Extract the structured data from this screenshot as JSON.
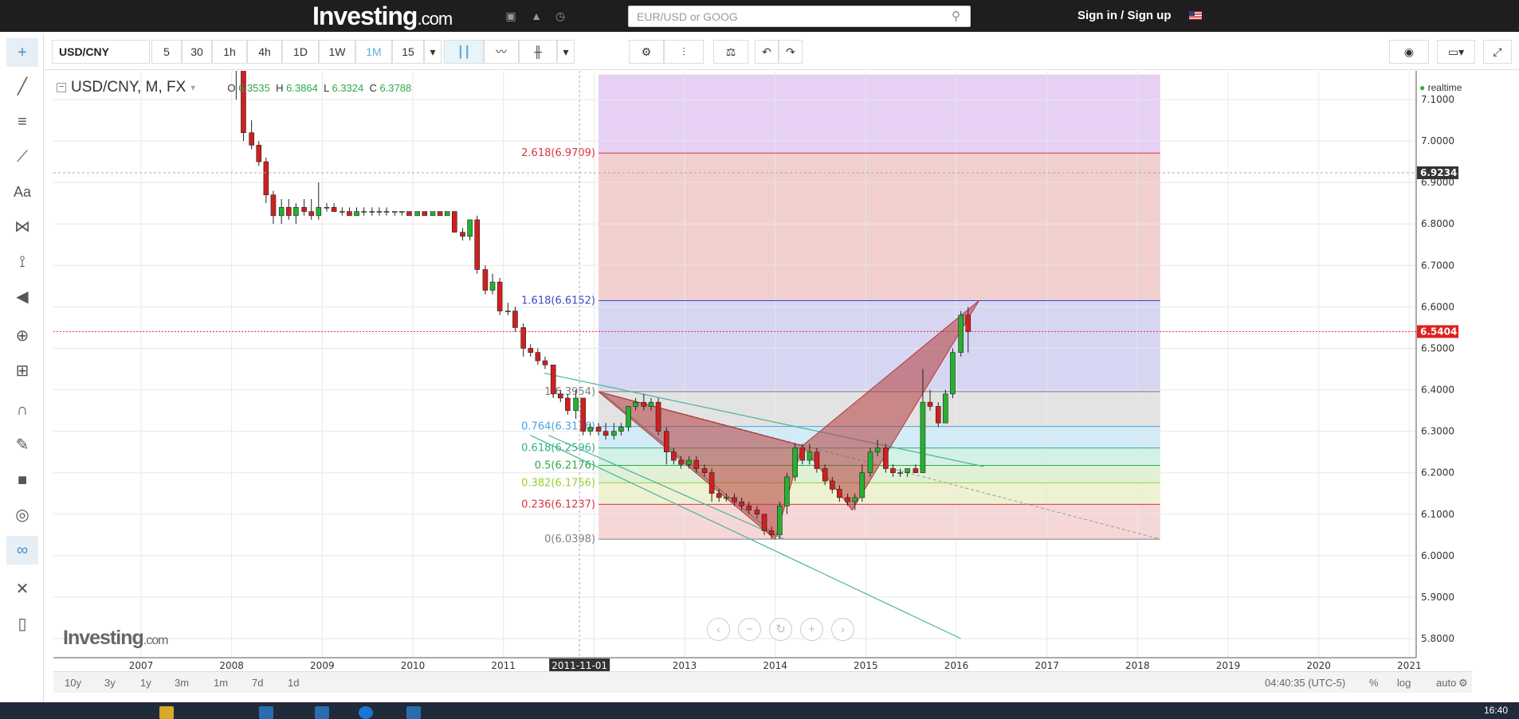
{
  "site": {
    "brand": "Investing",
    "brand_suffix": ".com",
    "search_placeholder": "EUR/USD or GOOG",
    "sign_in": "Sign in",
    "sign_sep": "/",
    "sign_up": "Sign up"
  },
  "toolbar": {
    "symbol": "USD/CNY",
    "intervals": [
      "5",
      "30",
      "1h",
      "4h",
      "1D",
      "1W",
      "1M",
      "15"
    ],
    "active_interval": "1M"
  },
  "legend": {
    "title": "USD/CNY, M, FX",
    "o_label": "O",
    "o": "6.3535",
    "h_label": "H",
    "h": "6.3864",
    "l_label": "L",
    "l": "6.3324",
    "c_label": "C",
    "c": "6.3788",
    "realtime": "realtime"
  },
  "chart_data": {
    "type": "candlestick",
    "x_axis_years": [
      "2007",
      "2008",
      "2009",
      "2010",
      "2011",
      "2012",
      "2013",
      "2014",
      "2015",
      "2016",
      "2017",
      "2018",
      "2019",
      "2020",
      "2021"
    ],
    "crosshair_date": "2011-11-01",
    "ylim": [
      5.76,
      7.16
    ],
    "y_ticks": [
      "7.1000",
      "7.0000",
      "6.9000",
      "6.8000",
      "6.7000",
      "6.6000",
      "6.5000",
      "6.4000",
      "6.3000",
      "6.2000",
      "6.1000",
      "6.0000",
      "5.9000",
      "5.8000"
    ],
    "last_price": "6.5404",
    "crosshair_price": "6.9234",
    "fib_levels": [
      {
        "label": "2.618(6.9709)",
        "value": 6.9709,
        "color": "#d9363e"
      },
      {
        "label": "1.618(6.6152)",
        "value": 6.6152,
        "color": "#4444cc"
      },
      {
        "label": "1(6.3954)",
        "value": 6.3954,
        "color": "#808080"
      },
      {
        "label": "0.764(6.3116)",
        "value": 6.3116,
        "color": "#4aa3df"
      },
      {
        "label": "0.618(6.2596)",
        "value": 6.2596,
        "color": "#2fb17e"
      },
      {
        "label": "0.5(6.2176)",
        "value": 6.2176,
        "color": "#2fa84a"
      },
      {
        "label": "0.382(6.1756)",
        "value": 6.1756,
        "color": "#9acd32"
      },
      {
        "label": "0.236(6.1237)",
        "value": 6.1237,
        "color": "#d9363e"
      },
      {
        "label": "0(6.0398)",
        "value": 6.0398,
        "color": "#808080"
      }
    ],
    "candles_monthly_close": [
      [
        2007.95,
        7.3,
        7.35,
        7.18,
        7.22
      ],
      [
        2008.05,
        7.22,
        7.25,
        7.1,
        7.18
      ],
      [
        2008.13,
        7.18,
        7.2,
        7.0,
        7.02
      ],
      [
        2008.22,
        7.02,
        7.05,
        6.98,
        6.99
      ],
      [
        2008.3,
        6.99,
        7.0,
        6.94,
        6.95
      ],
      [
        2008.38,
        6.95,
        6.96,
        6.85,
        6.87
      ],
      [
        2008.46,
        6.87,
        6.88,
        6.8,
        6.82
      ],
      [
        2008.55,
        6.82,
        6.86,
        6.8,
        6.84
      ],
      [
        2008.63,
        6.84,
        6.86,
        6.81,
        6.82
      ],
      [
        2008.71,
        6.82,
        6.85,
        6.8,
        6.84
      ],
      [
        2008.8,
        6.84,
        6.86,
        6.82,
        6.83
      ],
      [
        2008.88,
        6.83,
        6.86,
        6.81,
        6.82
      ],
      [
        2008.96,
        6.82,
        6.9,
        6.81,
        6.84
      ],
      [
        2009.05,
        6.84,
        6.85,
        6.83,
        6.84
      ],
      [
        2009.13,
        6.84,
        6.85,
        6.83,
        6.83
      ],
      [
        2009.22,
        6.83,
        6.84,
        6.82,
        6.83
      ],
      [
        2009.3,
        6.83,
        6.84,
        6.82,
        6.82
      ],
      [
        2009.38,
        6.82,
        6.84,
        6.82,
        6.83
      ],
      [
        2009.46,
        6.83,
        6.84,
        6.82,
        6.83
      ],
      [
        2009.55,
        6.83,
        6.84,
        6.82,
        6.83
      ],
      [
        2009.63,
        6.83,
        6.84,
        6.82,
        6.83
      ],
      [
        2009.71,
        6.83,
        6.84,
        6.82,
        6.83
      ],
      [
        2009.8,
        6.83,
        6.83,
        6.82,
        6.83
      ],
      [
        2009.88,
        6.83,
        6.83,
        6.82,
        6.83
      ],
      [
        2009.96,
        6.83,
        6.83,
        6.82,
        6.82
      ],
      [
        2010.05,
        6.82,
        6.83,
        6.82,
        6.83
      ],
      [
        2010.13,
        6.83,
        6.83,
        6.82,
        6.82
      ],
      [
        2010.22,
        6.82,
        6.83,
        6.82,
        6.83
      ],
      [
        2010.3,
        6.83,
        6.83,
        6.82,
        6.82
      ],
      [
        2010.38,
        6.82,
        6.83,
        6.82,
        6.83
      ],
      [
        2010.46,
        6.83,
        6.83,
        6.78,
        6.78
      ],
      [
        2010.55,
        6.78,
        6.79,
        6.76,
        6.77
      ],
      [
        2010.63,
        6.77,
        6.81,
        6.76,
        6.81
      ],
      [
        2010.71,
        6.81,
        6.82,
        6.68,
        6.69
      ],
      [
        2010.8,
        6.69,
        6.7,
        6.63,
        6.64
      ],
      [
        2010.88,
        6.64,
        6.68,
        6.63,
        6.66
      ],
      [
        2010.96,
        6.66,
        6.67,
        6.58,
        6.59
      ],
      [
        2011.05,
        6.59,
        6.61,
        6.58,
        6.59
      ],
      [
        2011.13,
        6.59,
        6.6,
        6.54,
        6.55
      ],
      [
        2011.22,
        6.55,
        6.56,
        6.48,
        6.5
      ],
      [
        2011.3,
        6.5,
        6.51,
        6.48,
        6.49
      ],
      [
        2011.38,
        6.49,
        6.5,
        6.46,
        6.47
      ],
      [
        2011.46,
        6.47,
        6.48,
        6.45,
        6.46
      ],
      [
        2011.55,
        6.46,
        6.46,
        6.38,
        6.39
      ],
      [
        2011.63,
        6.39,
        6.4,
        6.37,
        6.38
      ],
      [
        2011.71,
        6.38,
        6.39,
        6.34,
        6.35
      ],
      [
        2011.8,
        6.35,
        6.4,
        6.33,
        6.38
      ],
      [
        2011.88,
        6.38,
        6.38,
        6.29,
        6.3
      ],
      [
        2011.96,
        6.3,
        6.32,
        6.29,
        6.31
      ],
      [
        2012.05,
        6.31,
        6.32,
        6.29,
        6.3
      ],
      [
        2012.13,
        6.3,
        6.32,
        6.28,
        6.29
      ],
      [
        2012.22,
        6.29,
        6.32,
        6.28,
        6.3
      ],
      [
        2012.3,
        6.3,
        6.32,
        6.29,
        6.31
      ],
      [
        2012.38,
        6.31,
        6.36,
        6.3,
        6.36
      ],
      [
        2012.46,
        6.36,
        6.38,
        6.35,
        6.37
      ],
      [
        2012.55,
        6.37,
        6.39,
        6.35,
        6.36
      ],
      [
        2012.63,
        6.36,
        6.38,
        6.35,
        6.37
      ],
      [
        2012.71,
        6.37,
        6.38,
        6.29,
        6.3
      ],
      [
        2012.8,
        6.3,
        6.31,
        6.22,
        6.25
      ],
      [
        2012.88,
        6.25,
        6.26,
        6.22,
        6.23
      ],
      [
        2012.96,
        6.23,
        6.24,
        6.21,
        6.22
      ],
      [
        2013.05,
        6.22,
        6.24,
        6.21,
        6.23
      ],
      [
        2013.13,
        6.23,
        6.24,
        6.2,
        6.21
      ],
      [
        2013.22,
        6.21,
        6.22,
        6.19,
        6.2
      ],
      [
        2013.3,
        6.2,
        6.21,
        6.13,
        6.15
      ],
      [
        2013.38,
        6.15,
        6.16,
        6.13,
        6.14
      ],
      [
        2013.46,
        6.14,
        6.15,
        6.13,
        6.14
      ],
      [
        2013.55,
        6.14,
        6.15,
        6.12,
        6.13
      ],
      [
        2013.63,
        6.13,
        6.14,
        6.11,
        6.12
      ],
      [
        2013.71,
        6.12,
        6.13,
        6.1,
        6.11
      ],
      [
        2013.8,
        6.11,
        6.12,
        6.09,
        6.1
      ],
      [
        2013.88,
        6.1,
        6.1,
        6.05,
        6.06
      ],
      [
        2013.96,
        6.06,
        6.07,
        6.04,
        6.05
      ],
      [
        2014.05,
        6.05,
        6.13,
        6.04,
        6.12
      ],
      [
        2014.13,
        6.12,
        6.2,
        6.1,
        6.19
      ],
      [
        2014.22,
        6.19,
        6.27,
        6.18,
        6.26
      ],
      [
        2014.3,
        6.26,
        6.27,
        6.22,
        6.23
      ],
      [
        2014.38,
        6.23,
        6.27,
        6.22,
        6.25
      ],
      [
        2014.46,
        6.25,
        6.26,
        6.2,
        6.21
      ],
      [
        2014.55,
        6.21,
        6.22,
        6.17,
        6.18
      ],
      [
        2014.63,
        6.18,
        6.19,
        6.15,
        6.16
      ],
      [
        2014.71,
        6.16,
        6.17,
        6.13,
        6.14
      ],
      [
        2014.8,
        6.14,
        6.15,
        6.12,
        6.13
      ],
      [
        2014.88,
        6.13,
        6.15,
        6.11,
        6.14
      ],
      [
        2014.96,
        6.14,
        6.22,
        6.13,
        6.2
      ],
      [
        2015.05,
        6.2,
        6.26,
        6.19,
        6.25
      ],
      [
        2015.13,
        6.25,
        6.28,
        6.24,
        6.26
      ],
      [
        2015.22,
        6.26,
        6.27,
        6.2,
        6.21
      ],
      [
        2015.3,
        6.21,
        6.22,
        6.19,
        6.2
      ],
      [
        2015.38,
        6.2,
        6.21,
        6.19,
        6.2
      ],
      [
        2015.46,
        6.2,
        6.21,
        6.19,
        6.21
      ],
      [
        2015.55,
        6.21,
        6.22,
        6.2,
        6.2
      ],
      [
        2015.63,
        6.2,
        6.45,
        6.2,
        6.37
      ],
      [
        2015.71,
        6.37,
        6.4,
        6.35,
        6.36
      ],
      [
        2015.8,
        6.36,
        6.37,
        6.31,
        6.32
      ],
      [
        2015.88,
        6.32,
        6.4,
        6.32,
        6.39
      ],
      [
        2015.96,
        6.39,
        6.5,
        6.38,
        6.49
      ],
      [
        2016.05,
        6.49,
        6.59,
        6.48,
        6.58
      ],
      [
        2016.13,
        6.58,
        6.6,
        6.49,
        6.54
      ]
    ]
  },
  "harmonic_pattern": {
    "name": "bat-pattern"
  },
  "watermark": {
    "brand": "Investing",
    "suffix": ".com"
  },
  "zoom_controls": [
    "‹",
    "−",
    "↻",
    "+",
    "›"
  ],
  "bottom": {
    "ranges": [
      "10y",
      "3y",
      "1y",
      "3m",
      "1m",
      "7d",
      "1d"
    ],
    "time": "04:40:35 (UTC-5)",
    "percent": "%",
    "log": "log",
    "auto": "auto"
  },
  "taskbar": {
    "clock": "16:40"
  }
}
